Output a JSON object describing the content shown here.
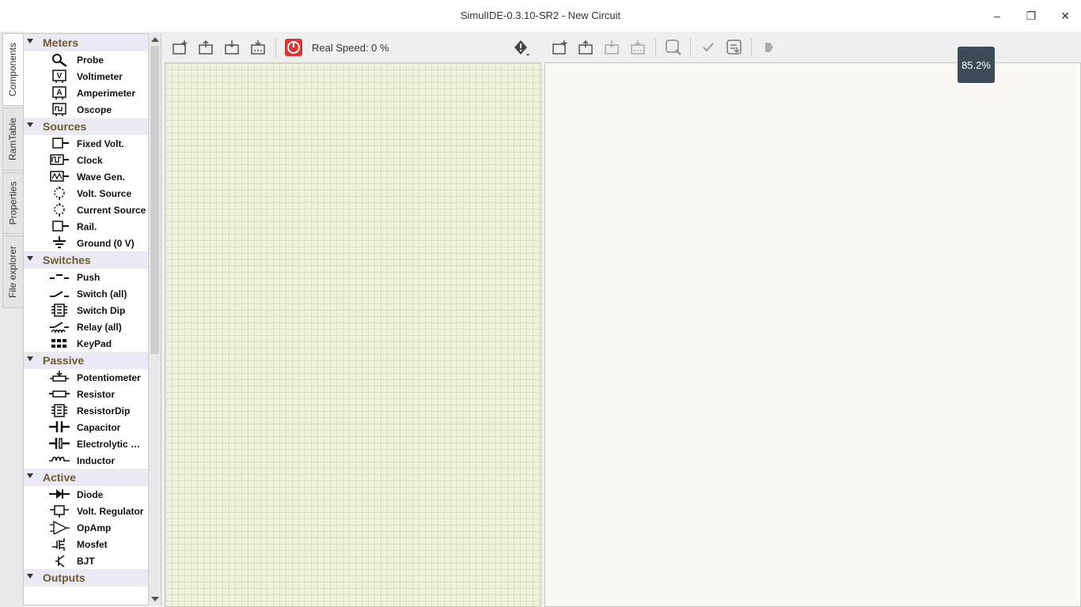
{
  "window": {
    "title": "SimulIDE-0.3.10-SR2 - New Circuit",
    "minimize": "–",
    "restore": "❐",
    "close": "✕"
  },
  "sidetabs": [
    "Components",
    "RamTable",
    "Properties",
    "File explorer"
  ],
  "toolbar": {
    "speed_label": "Real Speed: 0 %",
    "zoom": "85.2%"
  },
  "categories": [
    {
      "name": "Meters",
      "items": [
        {
          "label": "Probe",
          "icon": "probe-icon"
        },
        {
          "label": "Voltimeter",
          "icon": "voltmeter-icon"
        },
        {
          "label": "Amperimeter",
          "icon": "ammeter-icon"
        },
        {
          "label": "Oscope",
          "icon": "oscope-icon"
        }
      ]
    },
    {
      "name": "Sources",
      "items": [
        {
          "label": "Fixed Volt.",
          "icon": "fixed-volt-icon"
        },
        {
          "label": "Clock",
          "icon": "clock-icon"
        },
        {
          "label": "Wave Gen.",
          "icon": "wave-gen-icon"
        },
        {
          "label": "Volt. Source",
          "icon": "volt-source-icon"
        },
        {
          "label": "Current Source",
          "icon": "current-source-icon"
        },
        {
          "label": "Rail.",
          "icon": "rail-icon"
        },
        {
          "label": "Ground (0 V)",
          "icon": "ground-icon"
        }
      ]
    },
    {
      "name": "Switches",
      "items": [
        {
          "label": "Push",
          "icon": "push-icon"
        },
        {
          "label": "Switch (all)",
          "icon": "switch-icon"
        },
        {
          "label": "Switch Dip",
          "icon": "switch-dip-icon"
        },
        {
          "label": "Relay (all)",
          "icon": "relay-icon"
        },
        {
          "label": "KeyPad",
          "icon": "keypad-icon"
        }
      ]
    },
    {
      "name": "Passive",
      "items": [
        {
          "label": "Potentiometer",
          "icon": "potentiometer-icon"
        },
        {
          "label": "Resistor",
          "icon": "resistor-icon"
        },
        {
          "label": "ResistorDip",
          "icon": "resistor-dip-icon"
        },
        {
          "label": "Capacitor",
          "icon": "capacitor-icon"
        },
        {
          "label": "Electrolytic C…",
          "icon": "electrolytic-icon"
        },
        {
          "label": "Inductor",
          "icon": "inductor-icon"
        }
      ]
    },
    {
      "name": "Active",
      "items": [
        {
          "label": "Diode",
          "icon": "diode-icon"
        },
        {
          "label": "Volt. Regulator",
          "icon": "volt-regulator-icon"
        },
        {
          "label": "OpAmp",
          "icon": "opamp-icon"
        },
        {
          "label": "Mosfet",
          "icon": "mosfet-icon"
        },
        {
          "label": "BJT",
          "icon": "bjt-icon"
        }
      ]
    },
    {
      "name": "Outputs",
      "items": []
    }
  ]
}
